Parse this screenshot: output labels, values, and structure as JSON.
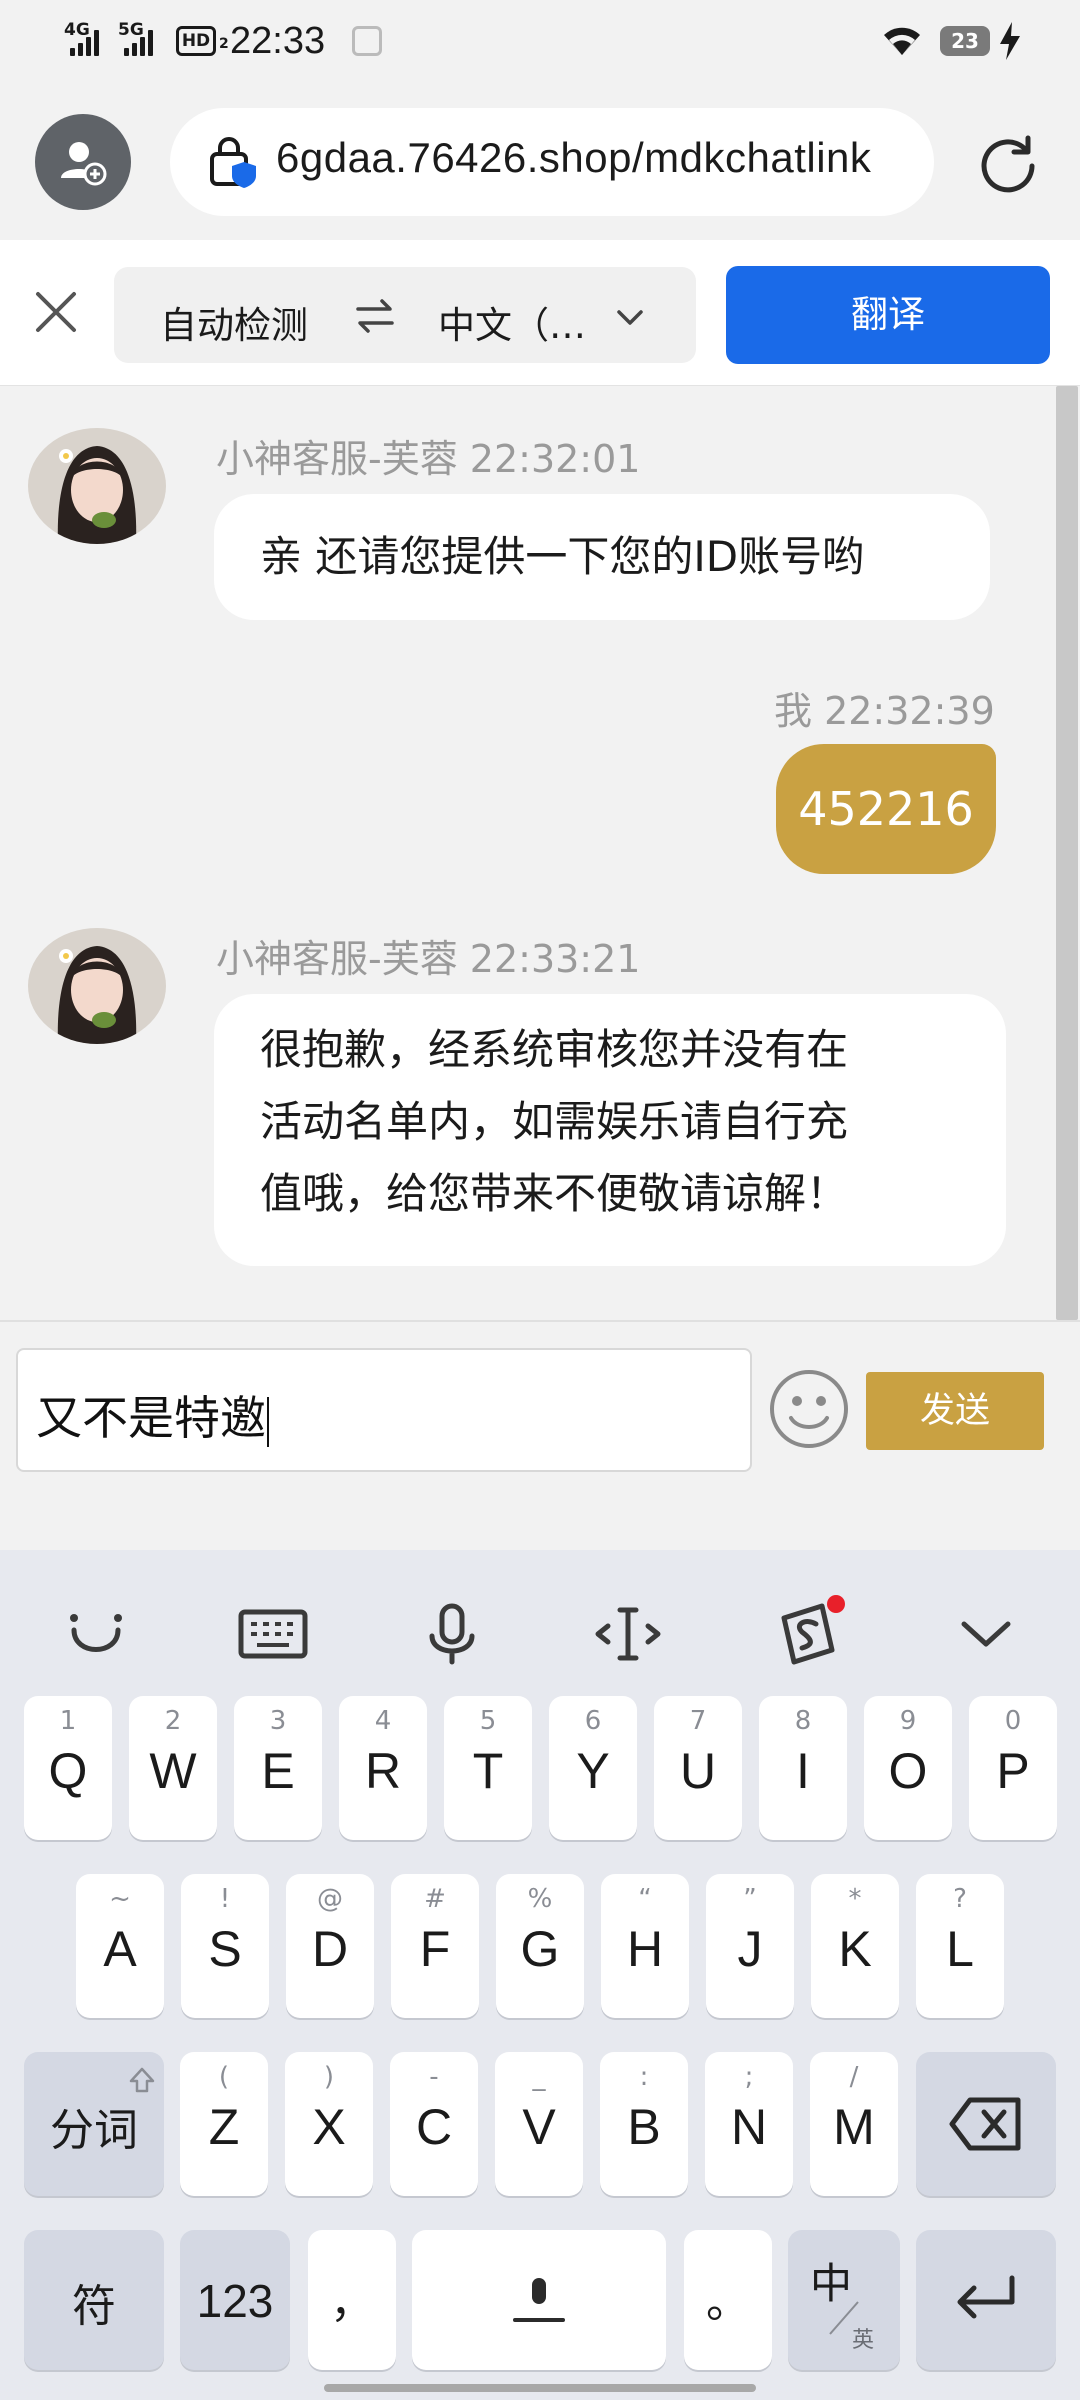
{
  "status_bar": {
    "network1": "4G",
    "network2": "5G",
    "hd": "HD",
    "hd_sub": "2",
    "time": "22:33",
    "battery": "23"
  },
  "browser": {
    "url": "6gdaa.76426.shop/mdkchatlink"
  },
  "translate_bar": {
    "source_lang": "自动检测",
    "target_lang": "中文（…",
    "translate_label": "翻译"
  },
  "chat": {
    "messages": [
      {
        "sender": "小神客服-芙蓉",
        "time": "22:32:01",
        "meta": "小神客服-芙蓉 22:32:01",
        "text": "亲 还请您提供一下您的ID账号哟",
        "direction": "in"
      },
      {
        "sender": "我",
        "time": "22:32:39",
        "meta": "我 22:32:39",
        "text": "452216",
        "direction": "out"
      },
      {
        "sender": "小神客服-芙蓉",
        "time": "22:33:21",
        "meta": "小神客服-芙蓉 22:33:21",
        "lines": [
          "很抱歉，经系统审核您并没有在",
          "活动名单内，如需娱乐请自行充",
          "值哦，给您带来不便敬请谅解！"
        ],
        "direction": "in"
      }
    ]
  },
  "composer": {
    "input_value": "又不是特邀",
    "send_label": "发送"
  },
  "keyboard": {
    "row1": [
      {
        "k": "Q",
        "s": "1"
      },
      {
        "k": "W",
        "s": "2"
      },
      {
        "k": "E",
        "s": "3"
      },
      {
        "k": "R",
        "s": "4"
      },
      {
        "k": "T",
        "s": "5"
      },
      {
        "k": "Y",
        "s": "6"
      },
      {
        "k": "U",
        "s": "7"
      },
      {
        "k": "I",
        "s": "8"
      },
      {
        "k": "O",
        "s": "9"
      },
      {
        "k": "P",
        "s": "0"
      }
    ],
    "row2": [
      {
        "k": "A",
        "s": "~"
      },
      {
        "k": "S",
        "s": "!"
      },
      {
        "k": "D",
        "s": "@"
      },
      {
        "k": "F",
        "s": "#"
      },
      {
        "k": "G",
        "s": "%"
      },
      {
        "k": "H",
        "s": "“"
      },
      {
        "k": "J",
        "s": "”"
      },
      {
        "k": "K",
        "s": "*"
      },
      {
        "k": "L",
        "s": "?"
      }
    ],
    "row3": [
      {
        "k": "Z",
        "s": "("
      },
      {
        "k": "X",
        "s": ")"
      },
      {
        "k": "C",
        "s": "-"
      },
      {
        "k": "V",
        "s": "_"
      },
      {
        "k": "B",
        "s": ":"
      },
      {
        "k": "N",
        "s": ";"
      },
      {
        "k": "M",
        "s": "/"
      }
    ],
    "segment_label": "分词",
    "symbol_label": "符",
    "num_label": "123",
    "comma_label": "，",
    "period_label": "。",
    "lang_main": "中",
    "lang_sub": "英"
  },
  "colors": {
    "accent_gold": "#c9a142",
    "translate_blue": "#1a6ae8"
  }
}
